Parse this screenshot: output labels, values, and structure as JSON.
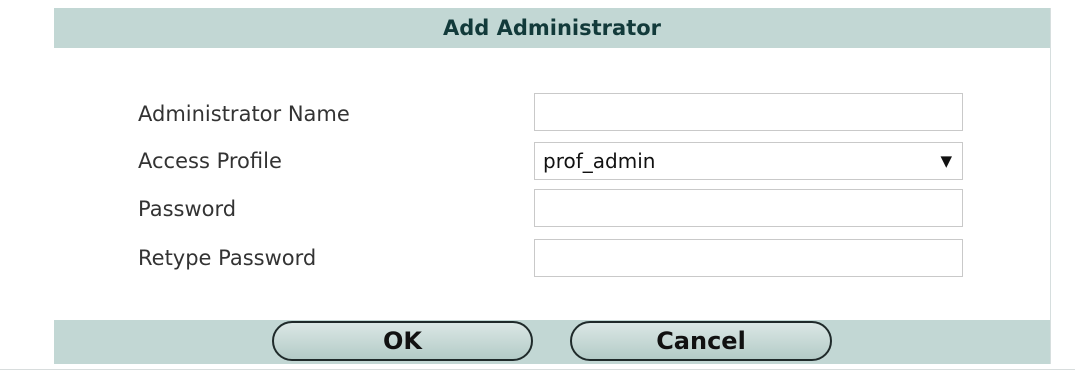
{
  "dialog": {
    "title": "Add Administrator"
  },
  "form": {
    "administrator_name": {
      "label": "Administrator Name",
      "value": ""
    },
    "access_profile": {
      "label": "Access Profile",
      "selected": "prof_admin",
      "arrow": "▼"
    },
    "password": {
      "label": "Password",
      "value": ""
    },
    "retype_password": {
      "label": "Retype Password",
      "value": ""
    }
  },
  "buttons": {
    "ok_label": "OK",
    "cancel_label": "Cancel"
  },
  "colors": {
    "bar_background": "#c2d7d4",
    "button_border": "#1f2a2a"
  }
}
